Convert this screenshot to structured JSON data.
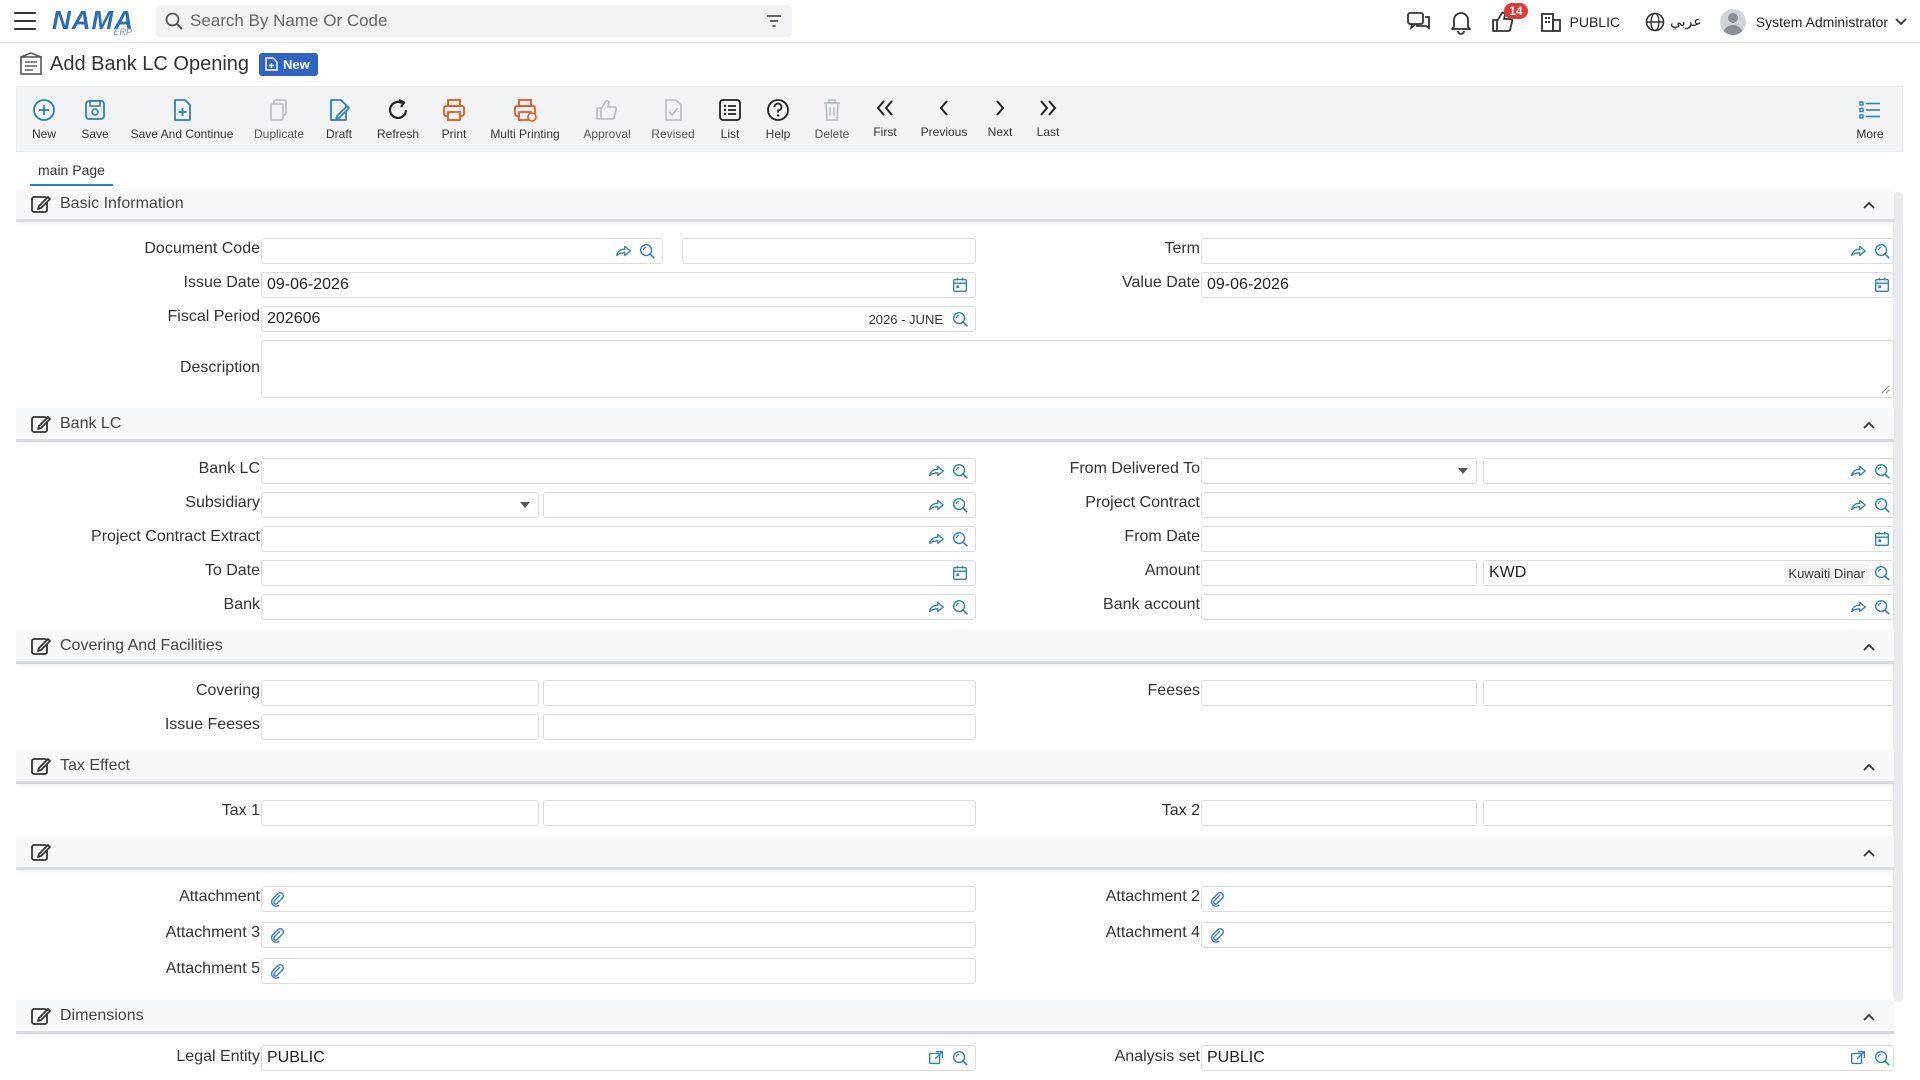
{
  "topbar": {
    "logo_text": "NAMA",
    "logo_sub": "ERP",
    "search_placeholder": "Search By Name Or Code",
    "notification_count": "14",
    "company": "PUBLIC",
    "language": "عربي",
    "user": "System Administrator"
  },
  "page": {
    "title": "Add Bank LC Opening",
    "badge": "New"
  },
  "toolbar": {
    "new": "New",
    "save": "Save",
    "save_continue": "Save And Continue",
    "duplicate": "Duplicate",
    "draft": "Draft",
    "refresh": "Refresh",
    "print": "Print",
    "multi_printing": "Multi Printing",
    "approval": "Approval",
    "revised": "Revised",
    "list": "List",
    "help": "Help",
    "delete": "Delete",
    "first": "First",
    "previous": "Previous",
    "next": "Next",
    "last": "Last",
    "more": "More"
  },
  "tabs": {
    "main": "main Page"
  },
  "sections": {
    "basic": {
      "title": "Basic Information",
      "document_code": "Document Code",
      "term": "Term",
      "issue_date": "Issue Date",
      "issue_date_value": "09-06-2026",
      "value_date": "Value Date",
      "value_date_value": "09-06-2026",
      "fiscal_period": "Fiscal Period",
      "fiscal_period_value": "202606",
      "fiscal_period_name": "2026 - JUNE",
      "description": "Description"
    },
    "bank_lc": {
      "title": "Bank LC",
      "bank_lc": "Bank LC",
      "from_delivered_to": "From Delivered To",
      "subsidiary": "Subsidiary",
      "project_contract": "Project Contract",
      "project_contract_extract": "Project Contract Extract",
      "from_date": "From Date",
      "to_date": "To Date",
      "amount": "Amount",
      "currency_code": "KWD",
      "currency_name": "Kuwaiti Dinar",
      "bank": "Bank",
      "bank_account": "Bank account"
    },
    "covering": {
      "title": "Covering And Facilities",
      "covering": "Covering",
      "feeses": "Feeses",
      "issue_feeses": "Issue Feeses"
    },
    "tax": {
      "title": "Tax Effect",
      "tax1": "Tax 1",
      "tax2": "Tax 2"
    },
    "attachments": {
      "title": "",
      "a1": "Attachment",
      "a2": "Attachment 2",
      "a3": "Attachment 3",
      "a4": "Attachment 4",
      "a5": "Attachment 5"
    },
    "dimensions": {
      "title": "Dimensions",
      "legal_entity": "Legal Entity",
      "legal_entity_value": "PUBLIC",
      "analysis_set": "Analysis set",
      "analysis_set_value": "PUBLIC"
    }
  },
  "colors": {
    "accent_blue": "#2f63c4",
    "link_blue": "#1e88c7",
    "print_orange": "#e8561d",
    "badge_red": "#e53935"
  }
}
